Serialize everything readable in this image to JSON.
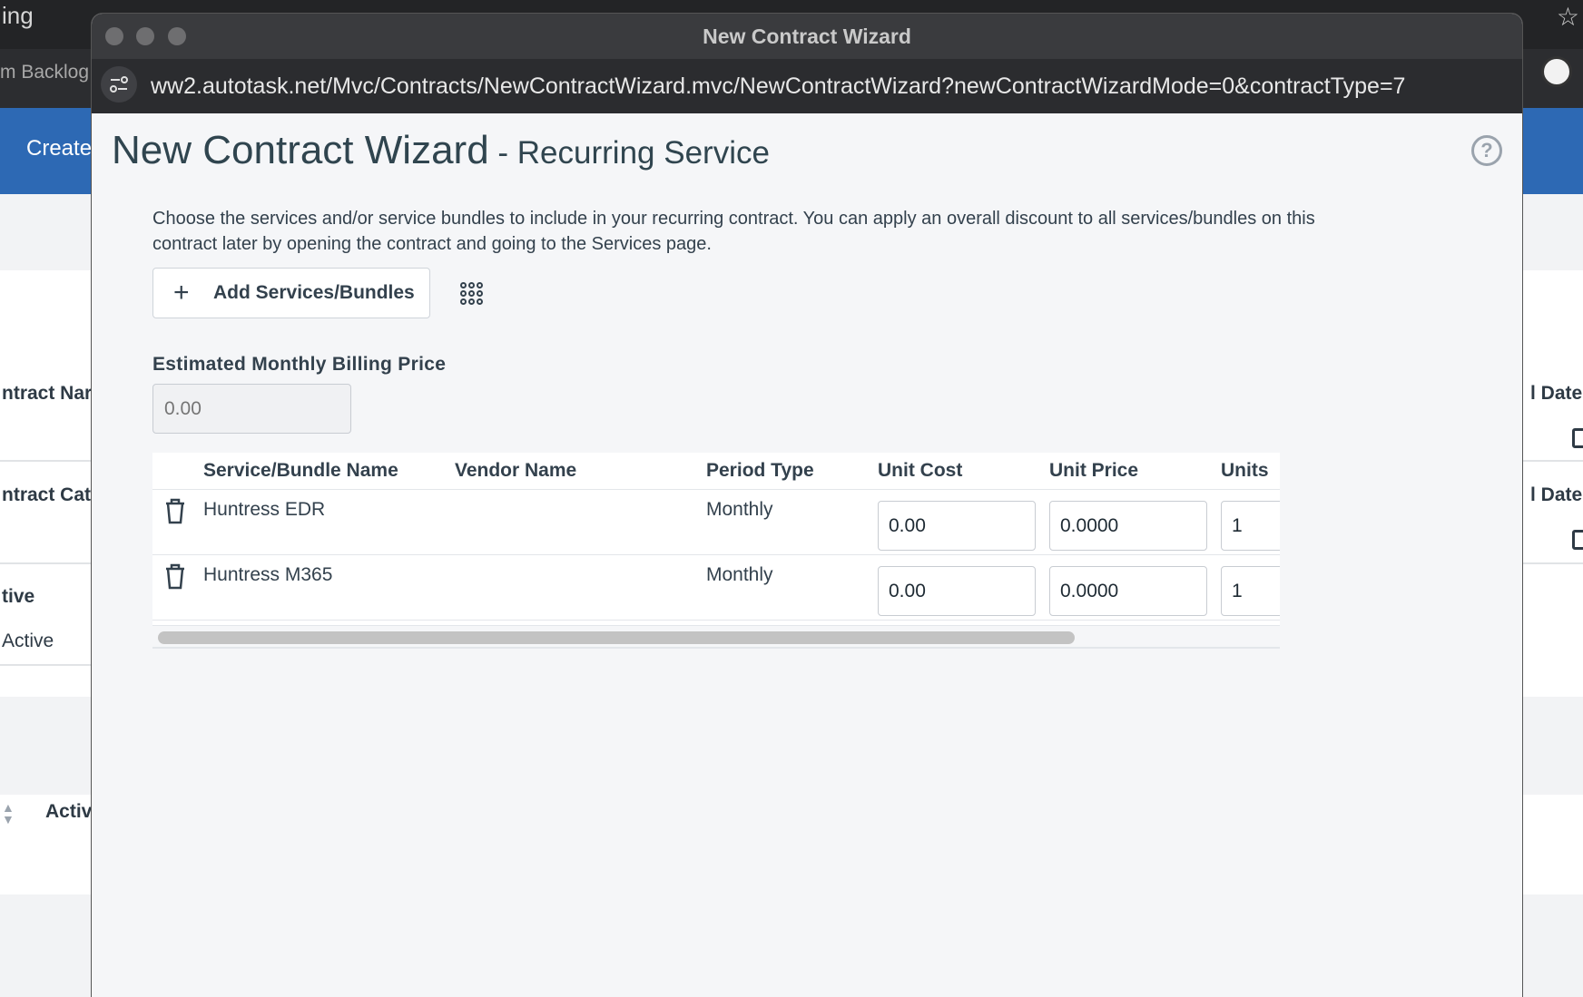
{
  "background": {
    "tab_text": "ing",
    "bookmark_text": "m Backlog",
    "create_text": "Create",
    "labels": {
      "contract_name": "ntract Nar",
      "contract_category": "ntract Cat",
      "active_label": "tive",
      "active_value": "Active",
      "end_date_1": "l Date",
      "end_date_2": "l Date",
      "active_column": "Activ"
    }
  },
  "window": {
    "title": "New Contract Wizard",
    "url": "ww2.autotask.net/Mvc/Contracts/NewContractWizard.mvc/NewContractWizard?newContractWizardMode=0&contractType=7"
  },
  "page": {
    "title_main": "New Contract Wizard",
    "title_sub": " - Recurring Service",
    "help_glyph": "?",
    "intro": "Choose the services and/or service bundles to include in your recurring contract. You can apply an overall discount to all services/bundles on this contract later by opening the contract and going to the Services page.",
    "add_button_label": "Add Services/Bundles",
    "estimated_label": "Estimated Monthly Billing Price",
    "estimated_placeholder": "0.00"
  },
  "table": {
    "columns": [
      "Service/Bundle Name",
      "Vendor Name",
      "Period Type",
      "Unit Cost",
      "Unit Price",
      "Units"
    ],
    "rows": [
      {
        "name": "Huntress EDR",
        "vendor": "",
        "period": "Monthly",
        "unit_cost": "0.00",
        "unit_price": "0.0000",
        "units": "1"
      },
      {
        "name": "Huntress M365",
        "vendor": "",
        "period": "Monthly",
        "unit_cost": "0.00",
        "unit_price": "0.0000",
        "units": "1"
      }
    ],
    "horizontal_scroll_fraction": 0.91
  },
  "colors": {
    "brand_blue": "#2d69b4",
    "heading": "#30454f",
    "text": "#33414d"
  }
}
